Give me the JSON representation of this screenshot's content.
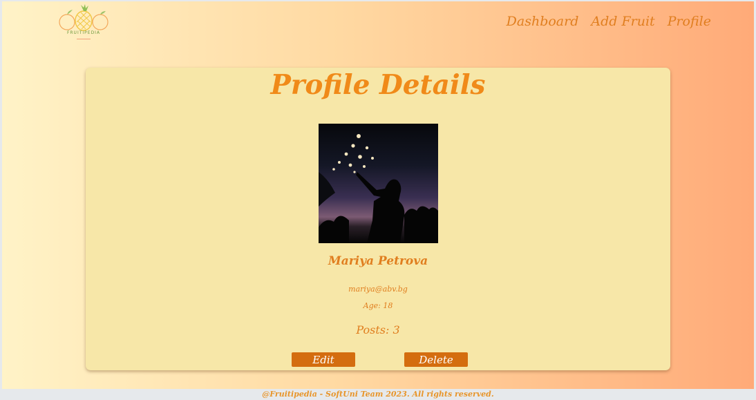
{
  "brand": {
    "logo_text": "FRUITIPEDIA"
  },
  "nav": {
    "dashboard": "Dashboard",
    "add_fruit": "Add Fruit",
    "profile": "Profile"
  },
  "profile": {
    "heading": "Profile Details",
    "name": "Mariya Petrova",
    "email": "mariya@abv.bg",
    "age": "Age: 18",
    "posts": "Posts: 3",
    "edit_label": "Edit",
    "delete_label": "Delete"
  },
  "footer": {
    "text": "@Fruitipedia - SoftUni Team 2023. All rights reserved."
  },
  "colors": {
    "accent": "#e07e1f",
    "heading": "#f08a19",
    "button": "#d46d0f",
    "card": "#f7e7a8"
  }
}
